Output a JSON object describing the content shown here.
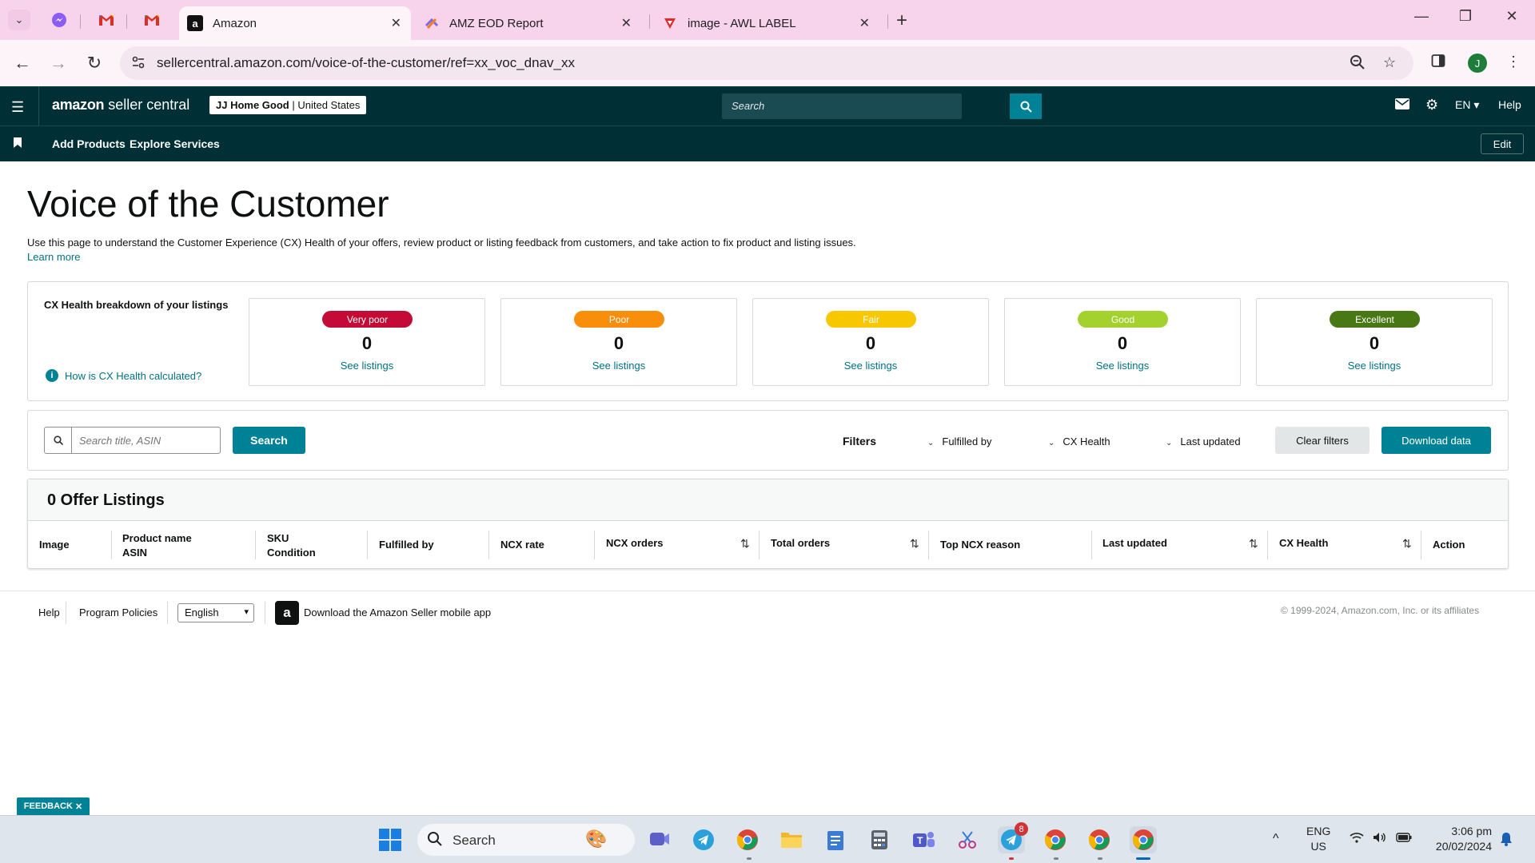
{
  "browser": {
    "tabs": [
      {
        "title": "Amazon",
        "active": true,
        "favicon": "amazon-icon"
      },
      {
        "title": "AMZ EOD Report",
        "active": false,
        "favicon": "clickup-icon"
      },
      {
        "title": "image - AWL LABEL",
        "active": false,
        "favicon": "vivaldi-icon"
      }
    ],
    "pinned_tabs": [
      "messenger-icon",
      "gmail-icon",
      "gmail-icon"
    ],
    "url": "sellercentral.amazon.com/voice-of-the-customer/ref=xx_voc_dnav_xx",
    "profile_initial": "J"
  },
  "seller_header": {
    "logo_amazon": "amazon",
    "logo_suffix": " seller central",
    "store_name": "JJ Home Good",
    "store_region": " | United States",
    "search_placeholder": "Search",
    "language": "EN",
    "help": "Help",
    "nav_links": [
      "Add Products",
      "Explore Services"
    ],
    "edit": "Edit"
  },
  "page": {
    "title": "Voice of the Customer",
    "description": "Use this page to understand the Customer Experience (CX) Health of your offers, review product or listing feedback from customers, and take action to fix product and listing issues.",
    "learn_more": "Learn more"
  },
  "cx_health": {
    "title": "CX Health breakdown of your listings",
    "help_link": "How is CX Health calculated?",
    "cards": [
      {
        "label": "Very poor",
        "count": "0",
        "link": "See listings",
        "color": "#c40b37"
      },
      {
        "label": "Poor",
        "count": "0",
        "link": "See listings",
        "color": "#f98e0b"
      },
      {
        "label": "Fair",
        "count": "0",
        "link": "See listings",
        "color": "#f7c702"
      },
      {
        "label": "Good",
        "count": "0",
        "link": "See listings",
        "color": "#a3d12d"
      },
      {
        "label": "Excellent",
        "count": "0",
        "link": "See listings",
        "color": "#487813"
      }
    ]
  },
  "filters": {
    "search_placeholder": "Search title, ASIN",
    "search_button": "Search",
    "label": "Filters",
    "dropdowns": [
      "Fulfilled by",
      "CX Health",
      "Last updated"
    ],
    "clear": "Clear filters",
    "download": "Download data"
  },
  "listings": {
    "title": "0 Offer Listings",
    "columns": [
      {
        "line1": "Image",
        "line2": ""
      },
      {
        "line1": "Product name",
        "line2": "ASIN"
      },
      {
        "line1": "SKU",
        "line2": "Condition"
      },
      {
        "line1": "Fulfilled by",
        "line2": ""
      },
      {
        "line1": "NCX rate",
        "line2": ""
      },
      {
        "line1": "NCX orders",
        "line2": ""
      },
      {
        "line1": "Total orders",
        "line2": ""
      },
      {
        "line1": "Top NCX reason",
        "line2": ""
      },
      {
        "line1": "Last updated",
        "line2": ""
      },
      {
        "line1": "CX Health",
        "line2": ""
      },
      {
        "line1": "Action",
        "line2": ""
      }
    ]
  },
  "footer": {
    "help": "Help",
    "policies": "Program Policies",
    "language": "English",
    "app_text": "Download the Amazon Seller mobile app",
    "copyright": "© 1999-2024, Amazon.com, Inc. or its affiliates"
  },
  "feedback": "FEEDBACK",
  "taskbar": {
    "search": "Search",
    "lang_line1": "ENG",
    "lang_line2": "US",
    "time": "3:06 pm",
    "date": "20/02/2024",
    "telegram_badge": "8"
  },
  "colors": {
    "seller_header_bg": "#002f36",
    "accent_teal": "#008296",
    "link": "#007185"
  }
}
